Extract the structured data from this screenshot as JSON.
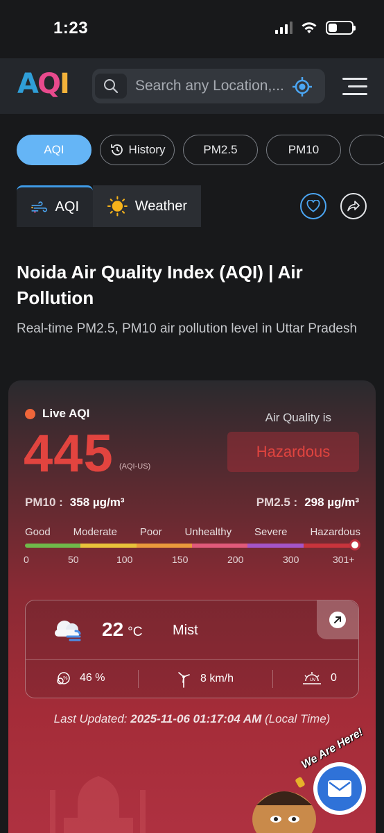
{
  "status": {
    "time": "1:23"
  },
  "header": {
    "logo": {
      "a": "A",
      "q": "Q",
      "i": "I"
    },
    "search_placeholder": "Search any Location,..."
  },
  "pills": [
    {
      "label": "AQI",
      "active": true
    },
    {
      "label": "History",
      "icon": "history-icon"
    },
    {
      "label": "PM2.5"
    },
    {
      "label": "PM10"
    }
  ],
  "tabs": {
    "aqi": "AQI",
    "weather": "Weather"
  },
  "page": {
    "title": "Noida Air Quality Index (AQI) | Air Pollution",
    "subtitle": "Real-time PM2.5, PM10 air pollution level in Uttar Pradesh"
  },
  "aqi_card": {
    "live_label": "Live AQI",
    "value": "445",
    "unit": "(AQI-US)",
    "quality_label": "Air Quality is",
    "quality": "Hazardous",
    "pm10_label": "PM10 :",
    "pm10_value": "358 µg/m³",
    "pm25_label": "PM2.5 :",
    "pm25_value": "298 µg/m³",
    "scale_labels": [
      "Good",
      "Moderate",
      "Poor",
      "Unhealthy",
      "Severe",
      "Hazardous"
    ],
    "scale_numbers": [
      "0",
      "50",
      "100",
      "150",
      "200",
      "300",
      "301+"
    ],
    "scale_colors": [
      "#6fb94a",
      "#e8c23a",
      "#ea9a3c",
      "#e05a7a",
      "#a455c8",
      "#c8343c"
    ]
  },
  "weather": {
    "temp": "22",
    "temp_unit": "°C",
    "condition": "Mist",
    "humidity": "46 %",
    "wind": "8 km/h",
    "uv": "0"
  },
  "last_updated": {
    "prefix": "Last Updated:",
    "datetime": "2025-11-06 01:17:04 AM",
    "suffix": "(Local Time)"
  },
  "chat": {
    "bubble_text": "We Are Here!"
  }
}
